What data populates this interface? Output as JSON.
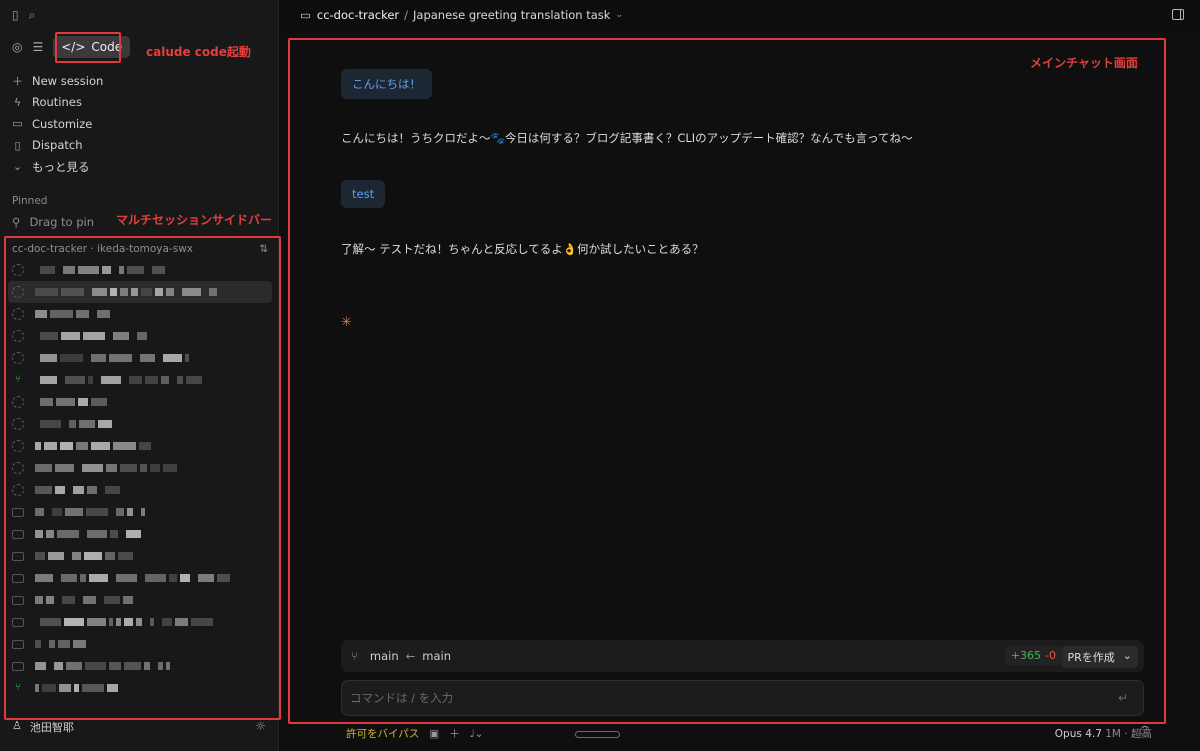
{
  "annotations": {
    "code_launch": "calude code起動",
    "sidebar": "マルチセッションサイドバー",
    "main_chat": "メインチャット画面"
  },
  "sidebar": {
    "mode_button": "Code",
    "menu": [
      {
        "icon": "plus-icon",
        "label": "New session"
      },
      {
        "icon": "bolt-icon",
        "label": "Routines"
      },
      {
        "icon": "briefcase-icon",
        "label": "Customize"
      },
      {
        "icon": "phone-icon",
        "label": "Dispatch"
      },
      {
        "icon": "chevron-down-icon",
        "label": "もっと見る"
      }
    ],
    "pinned_label": "Pinned",
    "drag_to_pin": "Drag to pin",
    "project_header": "cc-doc-tracker · ikeda-tomoya-swx",
    "user_name": "池田智耶"
  },
  "header": {
    "project": "cc-doc-tracker",
    "separator": "/",
    "task": "Japanese greeting translation task"
  },
  "chat": {
    "messages": [
      {
        "role": "user",
        "text": "こんにちは！"
      },
      {
        "role": "assistant",
        "text": "こんにちは！うちクロだよ〜🐾今日は何する？ブログ記事書く？CLIのアップデート確認？なんでも言ってね〜"
      },
      {
        "role": "user",
        "text": "test"
      },
      {
        "role": "assistant",
        "text": "了解〜 テストだね！ちゃんと反応してるよ👌何か試したいことある？"
      }
    ]
  },
  "branch_bar": {
    "target": "main",
    "source": "main",
    "additions": "+365",
    "deletions": "-0",
    "pr_button": "PRを作成"
  },
  "input": {
    "placeholder": "コマンドは / を入力"
  },
  "footer": {
    "bypass": "許可をバイパス",
    "model": "Opus 4.7",
    "context": "1M",
    "effort": "超高"
  },
  "colors": {
    "annotation_red": "#e0393e",
    "user_bubble_text": "#5aa0ec",
    "additions": "#3fb950",
    "deletions": "#e5534b",
    "bypass": "#d8b23a"
  }
}
